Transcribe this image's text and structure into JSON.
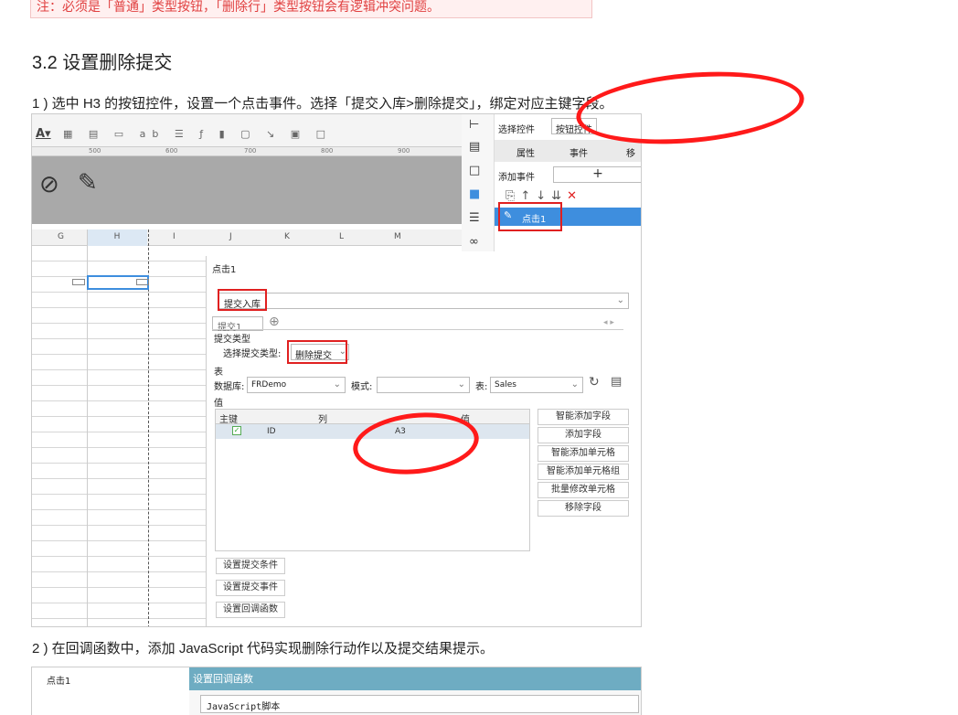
{
  "note_text": "注：必须是「普通」类型按钮，「删除行」类型按钮会有逻辑冲突问题。",
  "section_title": "3.2 设置删除提交",
  "step1": "1 ) 选中 H3 的按钮控件，设置一个点击事件。选择「提交入库>删除提交」，绑定对应主键字段。",
  "step2": "2 ) 在回调函数中，添加 JavaScript 代码实现删除行动作以及提交结果提示。",
  "ruler": [
    "500",
    "600",
    "700",
    "800",
    "900"
  ],
  "columns": [
    "G",
    "H",
    "I",
    "J",
    "K",
    "L",
    "M"
  ],
  "right_panel": {
    "select_widget": "选择控件",
    "button_widget": "按钮控件",
    "tab_props": "属性",
    "tab_events": "事件",
    "tab_move": "移",
    "add_event": "添加事件",
    "plus": "+",
    "event_item": "点击1"
  },
  "dialog": {
    "title": "点击1",
    "submit_dropdown": "提交入库",
    "tab_label": "提交1",
    "submit_type_section": "提交类型",
    "submit_type_label": "选择提交类型:",
    "submit_type_value": "删除提交",
    "table_section": "表",
    "db_label": "数据库:",
    "db_value": "FRDemo",
    "mode_label": "模式:",
    "table_label": "表:",
    "table_value": "Sales",
    "value_section": "值",
    "col_key": "主键",
    "col_col": "列",
    "col_val": "值",
    "row": {
      "col": "ID",
      "val": "A3"
    },
    "side_buttons": [
      "智能添加字段",
      "添加字段",
      "智能添加单元格",
      "智能添加单元格组",
      "批量修改单元格",
      "移除字段"
    ],
    "bottom_buttons": [
      "设置提交条件",
      "设置提交事件",
      "设置回调函数"
    ]
  },
  "shot2": {
    "title": "点击1",
    "dialog_title": "设置回调函数",
    "script_label": "JavaScript脚本"
  },
  "colors": {
    "accent_red": "#ff1a1a",
    "teal": "#6eacc2",
    "selected": "#3e8ede"
  }
}
